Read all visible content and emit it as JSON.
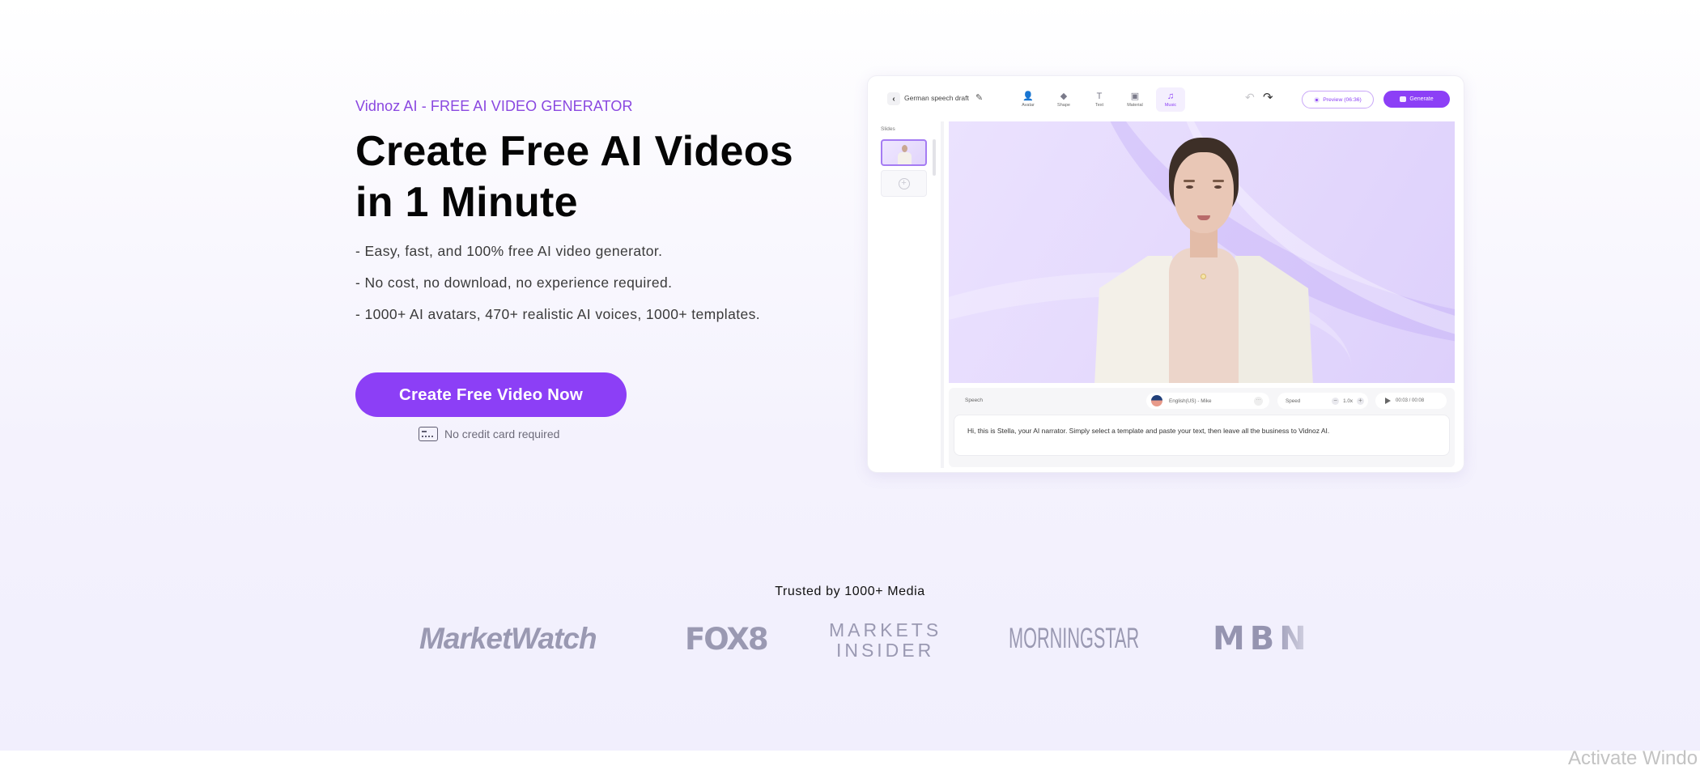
{
  "hero": {
    "eyebrow": "Vidnoz AI - FREE AI VIDEO GENERATOR",
    "headline_line1": "Create Free AI Videos",
    "headline_line2": "in 1 Minute",
    "bullets": [
      "- Easy, fast, and 100% free AI video generator.",
      "- No cost, no download, no experience required.",
      "- 1000+ AI avatars, 470+ realistic AI voices, 1000+ templates."
    ],
    "cta_label": "Create Free Video Now",
    "no_credit_card": "No credit card required",
    "accent_color": "#8c3ff6"
  },
  "editor": {
    "back_icon": "chevron-left-icon",
    "draft_title": "German speech draft",
    "edit_icon": "pencil-icon",
    "tools": [
      {
        "label": "Avatar",
        "icon": "avatar-icon",
        "glyph": "👤",
        "active": false
      },
      {
        "label": "Shape",
        "icon": "shape-icon",
        "glyph": "◆",
        "active": false
      },
      {
        "label": "Text",
        "icon": "text-icon",
        "glyph": "T",
        "active": false
      },
      {
        "label": "Material",
        "icon": "material-icon",
        "glyph": "▣",
        "active": false
      },
      {
        "label": "Music",
        "icon": "music-icon",
        "glyph": "♫",
        "active": true
      }
    ],
    "undo_glyph": "↶",
    "redo_glyph": "↷",
    "preview_label": "Preview (06:36)",
    "generate_label": "Generate",
    "slides_label": "Slides",
    "add_slide_glyph": "+",
    "speech": {
      "label": "Speech",
      "voice": "English(US) - Mike",
      "more_glyph": "···",
      "speed_label": "Speed",
      "speed_value": "1.0x",
      "minus_glyph": "−",
      "plus_glyph": "+",
      "time": "00:03 / 00:08",
      "text": "Hi, this is Stella, your AI narrator. Simply select a template and paste your text, then leave all the business to Vidnoz AI."
    }
  },
  "trusted": {
    "title": "Trusted by 1000+ Media",
    "logos": [
      {
        "name": "MarketWatch",
        "text": "MarketWatch"
      },
      {
        "name": "FOX8",
        "text": "FOX8"
      },
      {
        "name": "Markets Insider",
        "line1": "MARKETS",
        "line2": "INSIDER"
      },
      {
        "name": "Morningstar",
        "text": "MORNINGSTAR"
      },
      {
        "name": "MBN",
        "text": "MBN"
      }
    ]
  },
  "overlay": {
    "activate_windows": "Activate Windo"
  }
}
